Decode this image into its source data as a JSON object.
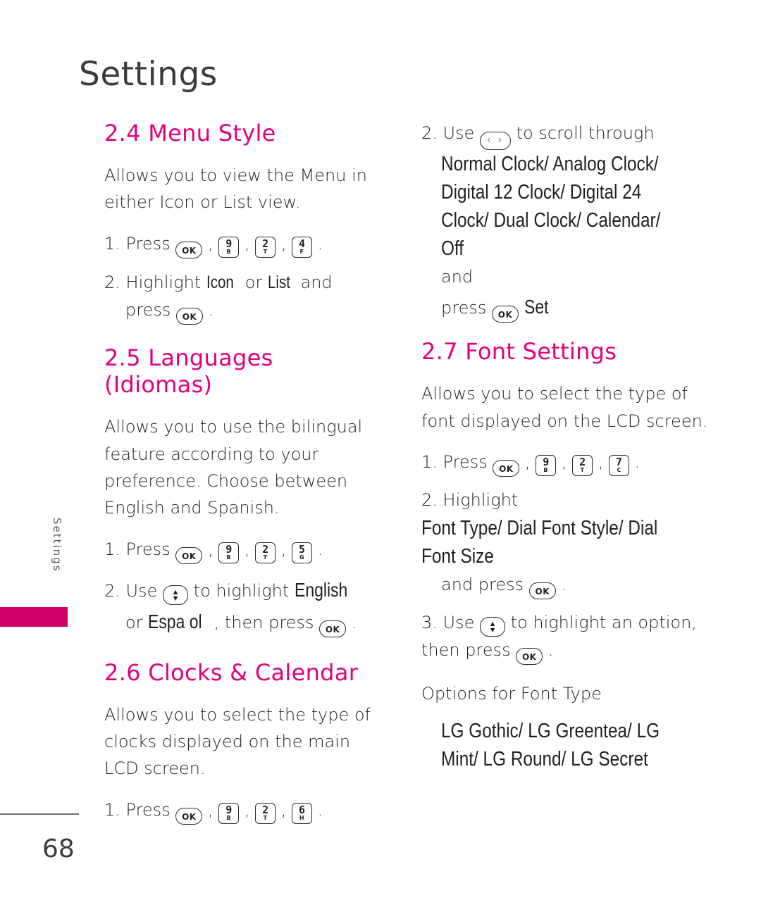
{
  "page": {
    "chapter_title": "Settings",
    "side_tab_label": "Settings",
    "page_number": "68"
  },
  "left_column": {
    "section_24": {
      "heading": "2.4 Menu Style",
      "intro": "Allows you to view the Menu in either Icon or List view.",
      "step1_prefix": "1. Press",
      "step1_keys": [
        "OK",
        "9",
        "2",
        "4"
      ],
      "step2_prefix": "2. Highlight",
      "step2_option_a": "Icon",
      "step2_or": "or",
      "step2_option_b": "List",
      "step2_and": "and",
      "step2_press": "press",
      "step2_key": "OK"
    },
    "section_25": {
      "heading": "2.5 Languages (Idiomas)",
      "intro": "Allows you to use the bilingual feature according to your preference. Choose between English and Spanish.",
      "step1_prefix": "1. Press",
      "step1_keys": [
        "OK",
        "9",
        "2",
        "5"
      ],
      "step2_prefix": "2. Use",
      "step2_mid": "to highlight",
      "step2_option_a": "English",
      "step2_or": "or",
      "step2_option_b": "Espa ol",
      "step2_tail": ", then press",
      "step2_key": "OK"
    },
    "section_26": {
      "heading": "2.6 Clocks & Calendar",
      "intro": "Allows you to select the type of clocks displayed on the main LCD screen.",
      "step1_prefix": "1. Press",
      "step1_keys": [
        "OK",
        "9",
        "2",
        "6"
      ]
    }
  },
  "right_column": {
    "section_26_cont": {
      "step2_prefix": "2. Use",
      "step2_mid": "to scroll through",
      "step2_options": "Normal Clock/ Analog Clock/ Digital 12 Clock/ Digital 24 Clock/ Dual Clock/ Calendar/ Off",
      "step2_and": "and",
      "step2_press": "press",
      "step2_key": "OK",
      "step2_set": "Set"
    },
    "section_27": {
      "heading": "2.7 Font Settings",
      "intro": "Allows you to select the type of font displayed on the LCD screen.",
      "step1_prefix": "1. Press",
      "step1_keys": [
        "OK",
        "9",
        "2",
        "7"
      ],
      "step2_prefix": "2. Highlight",
      "step2_options": "Font Type/ Dial Font Style/ Dial Font Size",
      "step2_tail": "and press",
      "step2_key": "OK",
      "step3_prefix": "3. Use",
      "step3_mid": "to highlight an option, then press",
      "step3_key": "OK",
      "options_label": "Options for Font Type",
      "options_values": "LG Gothic/ LG Greentea/ LG Mint/ LG Round/ LG Secret"
    }
  },
  "keys": {
    "ok": "OK",
    "k9": {
      "num": "9",
      "letters": "B"
    },
    "k2": {
      "num": "2",
      "letters": "T"
    },
    "k4": {
      "num": "4",
      "letters": "F"
    },
    "k5": {
      "num": "5",
      "letters": "G"
    },
    "k6": {
      "num": "6",
      "letters": "H"
    },
    "k7": {
      "num": "7",
      "letters": "C"
    },
    "nav_lr": "‹ ›",
    "nav_up": "▲",
    "nav_down": "▼"
  },
  "colors": {
    "accent": "#e3007f",
    "tab": "#cc0066",
    "text": "#231f20",
    "title": "#3b3b3b"
  }
}
